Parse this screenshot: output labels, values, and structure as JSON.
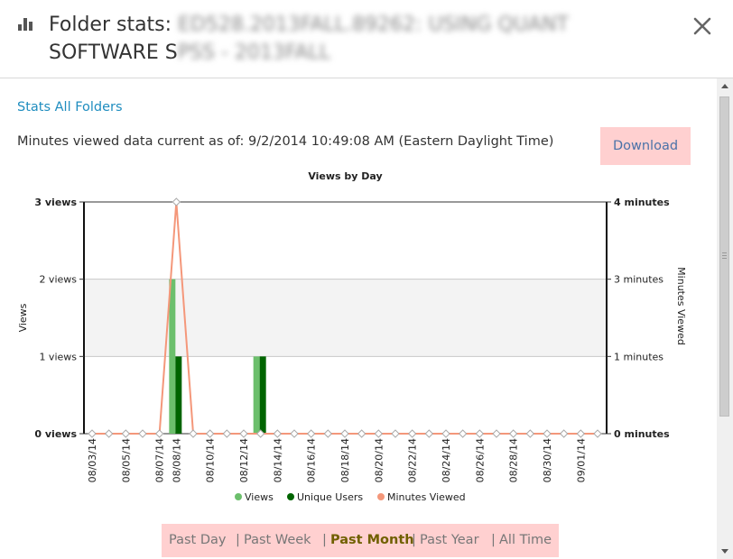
{
  "header": {
    "title_prefix": "Folder stats: ",
    "title_line1_obscured": "ED528.2013FALL.89262: USING QUANT",
    "title_line2_visible": "SOFTWARE S",
    "title_line2_obscured": "PSS - 2013FALL",
    "icon": "bar-chart-icon",
    "close_icon": "close-icon"
  },
  "links": {
    "stats_all_folders": "Stats All Folders"
  },
  "info": {
    "text": "Minutes viewed data current as of: 9/2/2014 10:49:08 AM (Eastern Daylight Time)"
  },
  "download": {
    "label": "Download"
  },
  "chart_data": {
    "type": "bar",
    "title": "Views by Day",
    "ylabel": "Views",
    "y2label": "Minutes Viewed",
    "ylim": [
      0,
      3
    ],
    "y2lim": [
      0,
      4
    ],
    "yticks": [
      "0 views",
      "1 views",
      "2 views",
      "3 views"
    ],
    "y2ticks": [
      "0 minutes",
      "1 minutes",
      "3 minutes",
      "4 minutes"
    ],
    "tick_labels": [
      "08/03/14",
      "08/05/14",
      "08/07/14",
      "08/08/14",
      "08/10/14",
      "08/12/14",
      "08/14/14",
      "08/16/14",
      "08/18/14",
      "08/20/14",
      "08/22/14",
      "08/24/14",
      "08/26/14",
      "08/28/14",
      "08/30/14",
      "09/01/14"
    ],
    "categories": [
      "08/03/14",
      "08/04/14",
      "08/05/14",
      "08/06/14",
      "08/07/14",
      "08/08/14",
      "08/09/14",
      "08/10/14",
      "08/11/14",
      "08/12/14",
      "08/13/14",
      "08/14/14",
      "08/15/14",
      "08/16/14",
      "08/17/14",
      "08/18/14",
      "08/19/14",
      "08/20/14",
      "08/21/14",
      "08/22/14",
      "08/23/14",
      "08/24/14",
      "08/25/14",
      "08/26/14",
      "08/27/14",
      "08/28/14",
      "08/29/14",
      "08/30/14",
      "08/31/14",
      "09/01/14",
      "09/02/14"
    ],
    "series": [
      {
        "name": "Views",
        "kind": "bar",
        "axis": "left",
        "color": "#6cbf6c",
        "values": [
          0,
          0,
          0,
          0,
          0,
          2,
          0,
          0,
          0,
          0,
          1,
          0,
          0,
          0,
          0,
          0,
          0,
          0,
          0,
          0,
          0,
          0,
          0,
          0,
          0,
          0,
          0,
          0,
          0,
          0,
          0
        ]
      },
      {
        "name": "Unique Users",
        "kind": "bar",
        "axis": "left",
        "color": "#006400",
        "values": [
          0,
          0,
          0,
          0,
          0,
          1,
          0,
          0,
          0,
          0,
          1,
          0,
          0,
          0,
          0,
          0,
          0,
          0,
          0,
          0,
          0,
          0,
          0,
          0,
          0,
          0,
          0,
          0,
          0,
          0,
          0
        ]
      },
      {
        "name": "Minutes Viewed",
        "kind": "line",
        "axis": "right",
        "color": "#f4977a",
        "values": [
          0,
          0,
          0,
          0,
          0,
          4,
          0,
          0,
          0,
          0,
          0,
          0,
          0,
          0,
          0,
          0,
          0,
          0,
          0,
          0,
          0,
          0,
          0,
          0,
          0,
          0,
          0,
          0,
          0,
          0,
          0
        ]
      }
    ],
    "legend": "bottom",
    "grid": true
  },
  "range": {
    "items": [
      {
        "label": "Past Day",
        "active": false
      },
      {
        "label": "Past Week",
        "active": false
      },
      {
        "label": "Past Month",
        "active": true
      },
      {
        "label": "Past Year",
        "active": false
      },
      {
        "label": "All Time",
        "active": false
      }
    ],
    "separator": "|"
  }
}
